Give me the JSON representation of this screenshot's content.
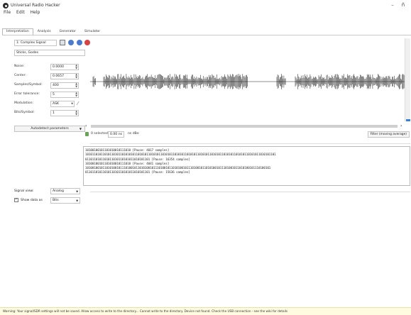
{
  "window": {
    "title": "Universal Radio Hacker",
    "minimize": "–",
    "maximize": "ñ"
  },
  "menu": [
    "File",
    "Edit",
    "Help"
  ],
  "tabs": [
    "Interpretation",
    "Analysis",
    "Generator",
    "Simulator"
  ],
  "signal": {
    "name": "1: Complex Signal",
    "display_name": "Sticks, Godes"
  },
  "params": [
    {
      "label": "Noise:",
      "value": "0.0000"
    },
    {
      "label": "Center:",
      "value": "0.0657"
    },
    {
      "label": "Samples/Symbol:",
      "value": "400"
    },
    {
      "label": "Error tolerance:",
      "value": "5"
    },
    {
      "label": "Modulation:",
      "value": "ASK"
    },
    {
      "label": "Bits/Symbol:",
      "value": "1"
    }
  ],
  "autodetect_label": "Autodetect parameters",
  "signal_view": {
    "label": "Signal view:",
    "value": "Analog"
  },
  "show_data": {
    "label": "Show data as",
    "value": "Bits"
  },
  "info": {
    "selected": "0 selected",
    "time": "0.00 ns",
    "extra": "ns dBe",
    "filter": "Filter (moving average)"
  },
  "bits": [
    "10100100101101010010111010 [Pause: 4017 samples]",
    "1010110101101011010110101010110101011010101101010110101011010101101010110101011010101101010110101011010101101",
    "0110110101101011010110101011010101101 [Pause: 16354 samples]",
    "10100100101101010010111010 [Pause: 4041 samples]",
    "1010010010110101001011101001011010100101110100101101010010111010010110101001011101001011010100101110100101",
    "0110110101101011010110101011010101101 [Pause: 15636 samples]"
  ],
  "status": "Warning: Your signal/SDR settings will not be saved. Allow access to write to the directory... Cannot write to the directory. Device not found. Check the USB connection - see the wiki for details"
}
